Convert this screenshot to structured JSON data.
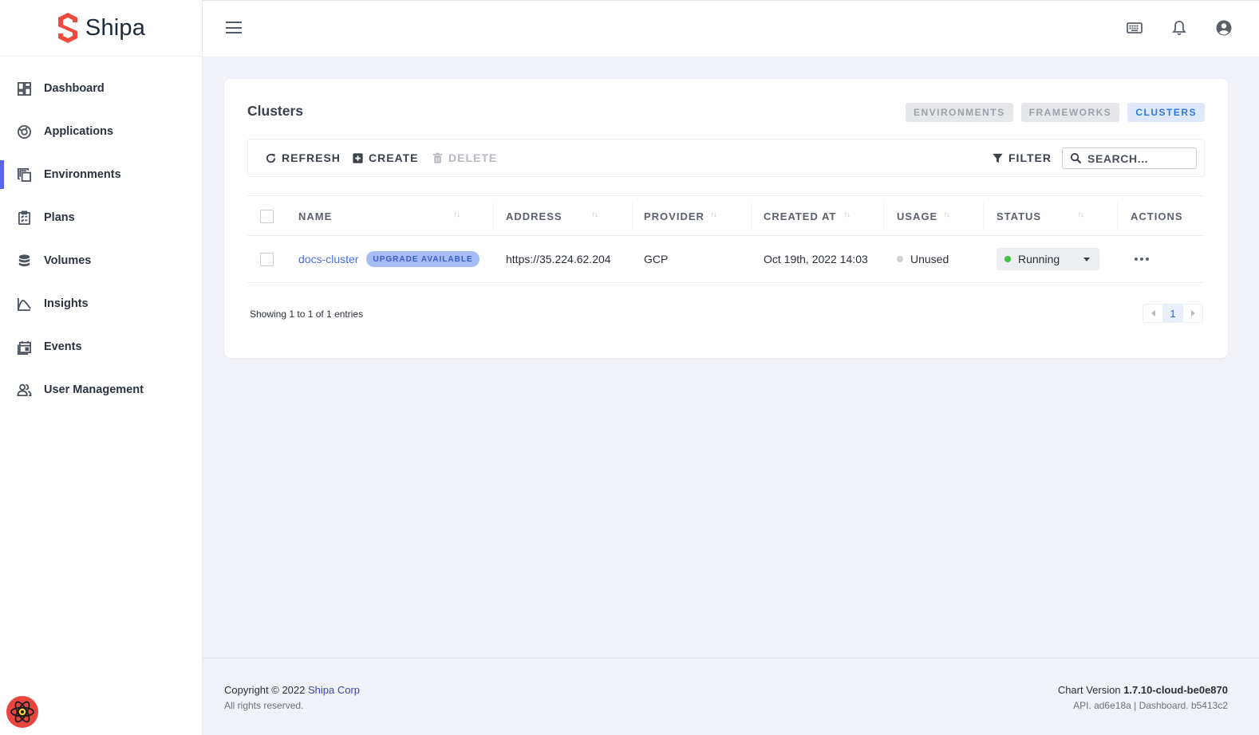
{
  "brand": {
    "name": "Shipa",
    "logo_color": "#ef4a3b"
  },
  "sidebar": {
    "items": [
      {
        "label": "Dashboard",
        "icon": "dashboard-icon"
      },
      {
        "label": "Applications",
        "icon": "applications-icon"
      },
      {
        "label": "Environments",
        "icon": "environments-icon",
        "active": true
      },
      {
        "label": "Plans",
        "icon": "plans-icon"
      },
      {
        "label": "Volumes",
        "icon": "volumes-icon"
      },
      {
        "label": "Insights",
        "icon": "insights-icon"
      },
      {
        "label": "Events",
        "icon": "events-icon"
      },
      {
        "label": "User Management",
        "icon": "users-icon"
      }
    ],
    "active_color": "#5b63e8"
  },
  "topbar": {
    "icons": [
      "menu-icon",
      "keyboard-icon",
      "bell-icon",
      "account-icon"
    ]
  },
  "card": {
    "title": "Clusters",
    "tabs": [
      {
        "label": "ENVIRONMENTS",
        "active": false
      },
      {
        "label": "FRAMEWORKS",
        "active": false
      },
      {
        "label": "CLUSTERS",
        "active": true
      }
    ],
    "toolbar": {
      "refresh": "REFRESH",
      "create": "CREATE",
      "delete": "DELETE",
      "filter": "FILTER",
      "search_placeholder": "SEARCH..."
    },
    "table": {
      "columns": [
        "NAME",
        "ADDRESS",
        "PROVIDER",
        "CREATED AT",
        "USAGE",
        "STATUS",
        "ACTIONS"
      ],
      "rows": [
        {
          "name": "docs-cluster",
          "badge": "UPGRADE AVAILABLE",
          "address": "https://35.224.62.204",
          "provider": "GCP",
          "created_at": "Oct 19th, 2022 14:03",
          "usage": "Unused",
          "status": "Running"
        }
      ]
    },
    "entries_text": "Showing 1 to 1 of 1 entries",
    "current_page": "1"
  },
  "colors": {
    "usage_dot": "#cfd1d5",
    "status_dot": "#3cc23b",
    "link": "#4c6ed8"
  },
  "footer": {
    "copyright_prefix": "Copyright © 2022",
    "company": "Shipa Corp",
    "rights": "All rights reserved.",
    "chart_version_label": "Chart Version",
    "chart_version": "1.7.10-cloud-be0e870",
    "build_info": "API. ad6e18a | Dashboard. b5413c2"
  }
}
